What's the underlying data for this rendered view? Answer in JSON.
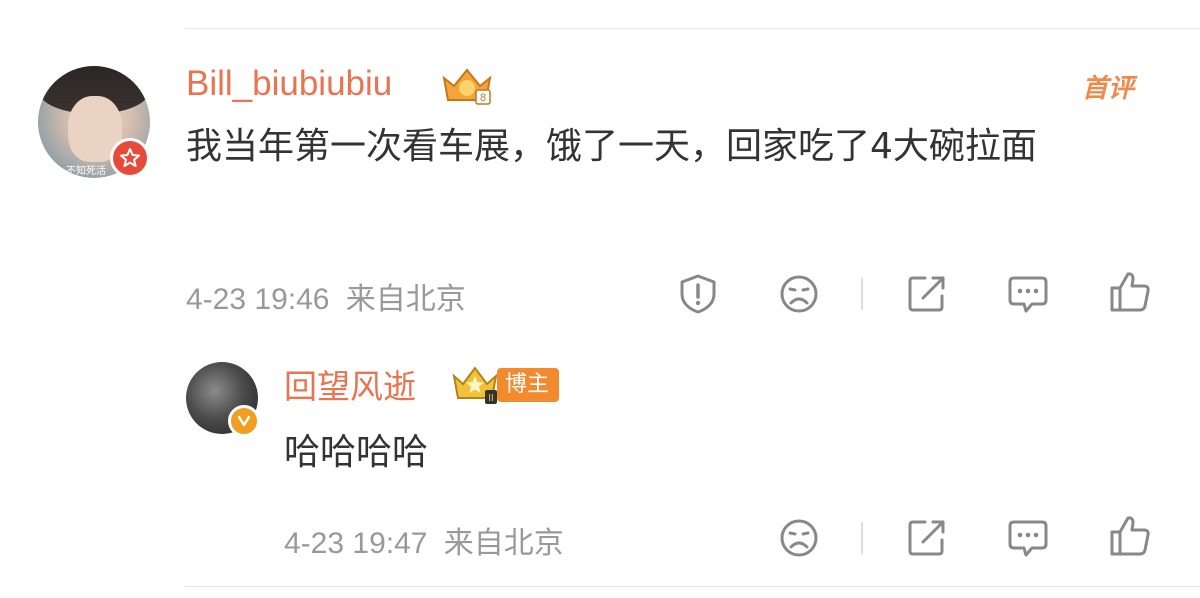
{
  "main_comment": {
    "username": "Bill_biubiubiu",
    "avatar_caption": "不知死活",
    "first_comment_label": "首评",
    "text": "我当年第一次看车展，饿了一天，回家吃了4大碗拉面",
    "time": "4-23 19:46",
    "location": "来自北京"
  },
  "reply": {
    "username": "回望风逝",
    "role_tag": "博主",
    "text": "哈哈哈哈",
    "time": "4-23 19:47",
    "location": "来自北京"
  },
  "icons": {
    "report": "shield-exclamation-icon",
    "dislike": "sad-face-icon",
    "share": "share-icon",
    "comment": "comment-bubble-icon",
    "like": "thumbs-up-icon",
    "vip_crown": "crown-icon",
    "verified": "verified-badge-icon"
  },
  "colors": {
    "username": "#eb7350",
    "meta": "#999999",
    "text": "#333333",
    "icon": "#888888"
  }
}
